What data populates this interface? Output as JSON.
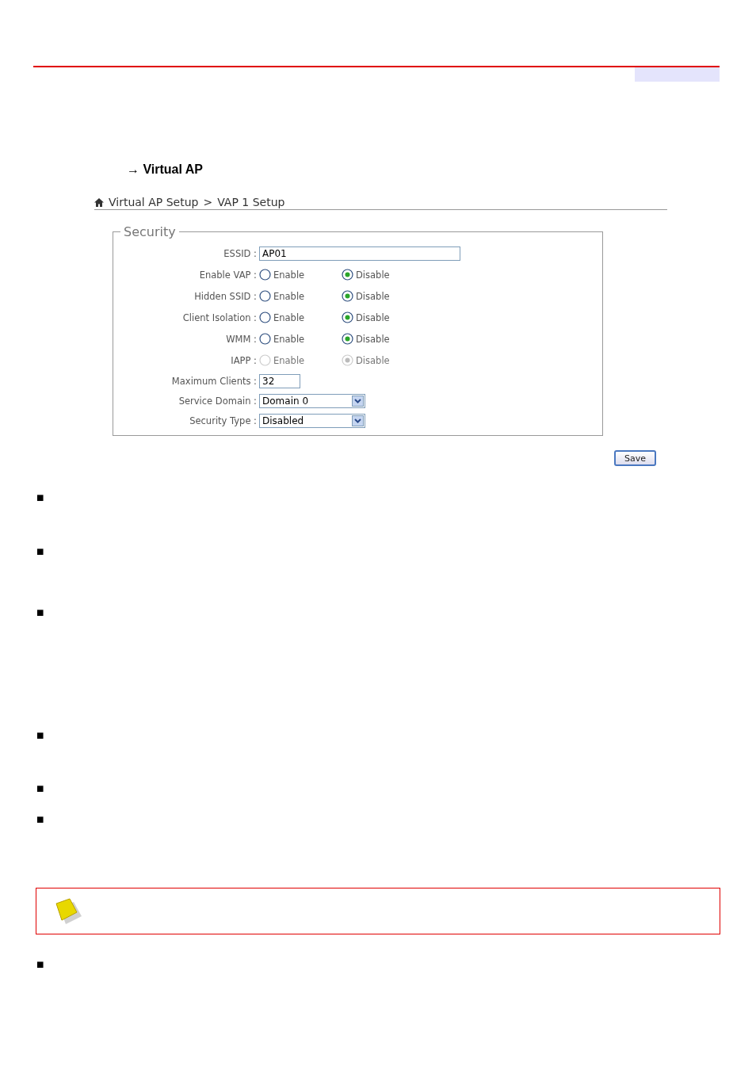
{
  "heading": "→ Virtual AP",
  "breadcrumb": {
    "items": [
      "Virtual AP Setup",
      "VAP 1 Setup"
    ],
    "separator": ">"
  },
  "panel": {
    "legend": "Security",
    "fields": [
      {
        "kind": "text",
        "label": "ESSID :",
        "value": "AP01"
      },
      {
        "kind": "radio",
        "label": "Enable VAP :",
        "options": [
          {
            "label": "Enable",
            "selected": false,
            "disabled": false
          },
          {
            "label": "Disable",
            "selected": true,
            "disabled": false
          }
        ]
      },
      {
        "kind": "radio",
        "label": "Hidden SSID :",
        "options": [
          {
            "label": "Enable",
            "selected": false,
            "disabled": false
          },
          {
            "label": "Disable",
            "selected": true,
            "disabled": false
          }
        ]
      },
      {
        "kind": "radio",
        "label": "Client Isolation :",
        "options": [
          {
            "label": "Enable",
            "selected": false,
            "disabled": false
          },
          {
            "label": "Disable",
            "selected": true,
            "disabled": false
          }
        ]
      },
      {
        "kind": "radio",
        "label": "WMM :",
        "options": [
          {
            "label": "Enable",
            "selected": false,
            "disabled": false
          },
          {
            "label": "Disable",
            "selected": true,
            "disabled": false
          }
        ]
      },
      {
        "kind": "radio",
        "label": "IAPP :",
        "options": [
          {
            "label": "Enable",
            "selected": false,
            "disabled": true
          },
          {
            "label": "Disable",
            "selected": true,
            "disabled": true
          }
        ]
      },
      {
        "kind": "short",
        "label": "Maximum Clients :",
        "value": "32"
      },
      {
        "kind": "select",
        "label": "Service Domain :",
        "value": "Domain 0"
      },
      {
        "kind": "select",
        "label": "Security Type :",
        "value": "Disabled"
      }
    ]
  },
  "save_button": "Save",
  "bullets": [
    "■",
    "■",
    "■",
    "■",
    "■",
    "■"
  ],
  "note": {
    "kind": "note"
  },
  "last_bullet": "■"
}
